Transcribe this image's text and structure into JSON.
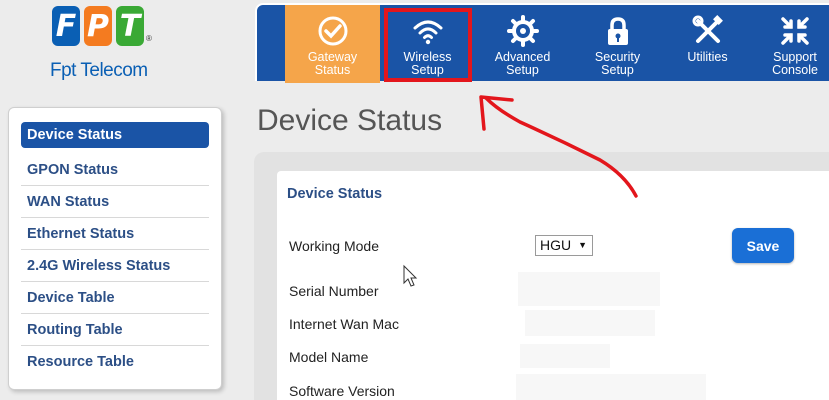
{
  "logo": {
    "letters": [
      "F",
      "P",
      "T"
    ],
    "reg": "®",
    "text": "Fpt Telecom"
  },
  "nav": [
    {
      "label1": "Gateway",
      "label2": "Status",
      "icon": "check-circle-icon"
    },
    {
      "label1": "Wireless",
      "label2": "Setup",
      "icon": "wifi-icon"
    },
    {
      "label1": "Advanced",
      "label2": "Setup",
      "icon": "gear-icon"
    },
    {
      "label1": "Security",
      "label2": "Setup",
      "icon": "lock-icon"
    },
    {
      "label1": "Utilities",
      "label2": "",
      "icon": "tools-icon"
    },
    {
      "label1": "Support",
      "label2": "Console",
      "icon": "arrows-icon"
    }
  ],
  "sidebar": {
    "items": [
      {
        "label": "Device Status"
      },
      {
        "label": "GPON Status"
      },
      {
        "label": "WAN Status"
      },
      {
        "label": "Ethernet Status"
      },
      {
        "label": "2.4G Wireless Status"
      },
      {
        "label": "Device Table"
      },
      {
        "label": "Routing Table"
      },
      {
        "label": "Resource Table"
      }
    ]
  },
  "main": {
    "title": "Device Status",
    "panel_title": "Device Status",
    "rows": [
      {
        "label": "Working Mode"
      },
      {
        "label": "Serial Number"
      },
      {
        "label": "Internet Wan Mac"
      },
      {
        "label": "Model Name"
      },
      {
        "label": "Software Version"
      }
    ],
    "working_mode_value": "HGU",
    "save_label": "Save"
  },
  "colors": {
    "nav_bg": "#1a54a6",
    "active_nav": "#f5a54a",
    "annotation": "#e3161c",
    "link": "#2c4f86"
  }
}
